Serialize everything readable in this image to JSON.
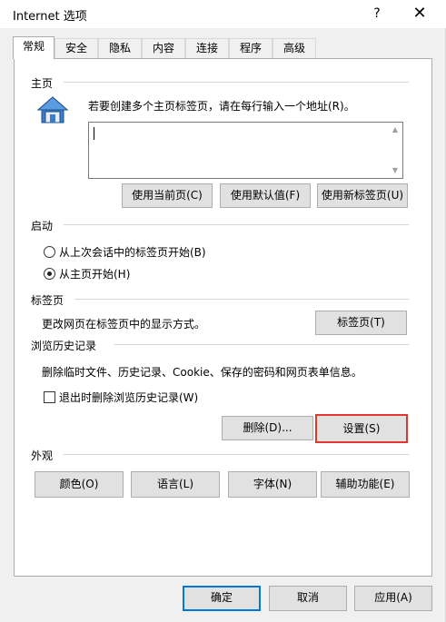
{
  "window": {
    "title": "Internet 选项",
    "help_label": "?",
    "close_label": "✕"
  },
  "tabs": [
    {
      "label": "常规",
      "active": true
    },
    {
      "label": "安全"
    },
    {
      "label": "隐私"
    },
    {
      "label": "内容"
    },
    {
      "label": "连接"
    },
    {
      "label": "程序"
    },
    {
      "label": "高级"
    }
  ],
  "home": {
    "section_title": "主页",
    "icon": "house-icon",
    "description": "若要创建多个主页标签页，请在每行输入一个地址(R)。",
    "textarea_value": "",
    "buttons": [
      "使用当前页(C)",
      "使用默认值(F)",
      "使用新标签页(U)"
    ]
  },
  "startup": {
    "section_title": "启动",
    "options": [
      {
        "label": "从上次会话中的标签页开始(B)",
        "checked": false
      },
      {
        "label": "从主页开始(H)",
        "checked": true
      }
    ]
  },
  "tabs_section": {
    "section_title": "标签页",
    "description": "更改网页在标签页中的显示方式。",
    "button": "标签页(T)"
  },
  "history": {
    "section_title": "浏览历史记录",
    "description": "删除临时文件、历史记录、Cookie、保存的密码和网页表单信息。",
    "checkbox_label": "退出时删除浏览历史记录(W)",
    "checkbox_checked": false,
    "delete_button": "删除(D)...",
    "settings_button": "设置(S)"
  },
  "appearance": {
    "section_title": "外观",
    "buttons": [
      "颜色(O)",
      "语言(L)",
      "字体(N)",
      "辅助功能(E)"
    ]
  },
  "footer": {
    "ok": "确定",
    "cancel": "取消",
    "apply": "应用(A)"
  },
  "colors": {
    "highlight": "#e0372e",
    "default_button_border": "#0078d7"
  }
}
